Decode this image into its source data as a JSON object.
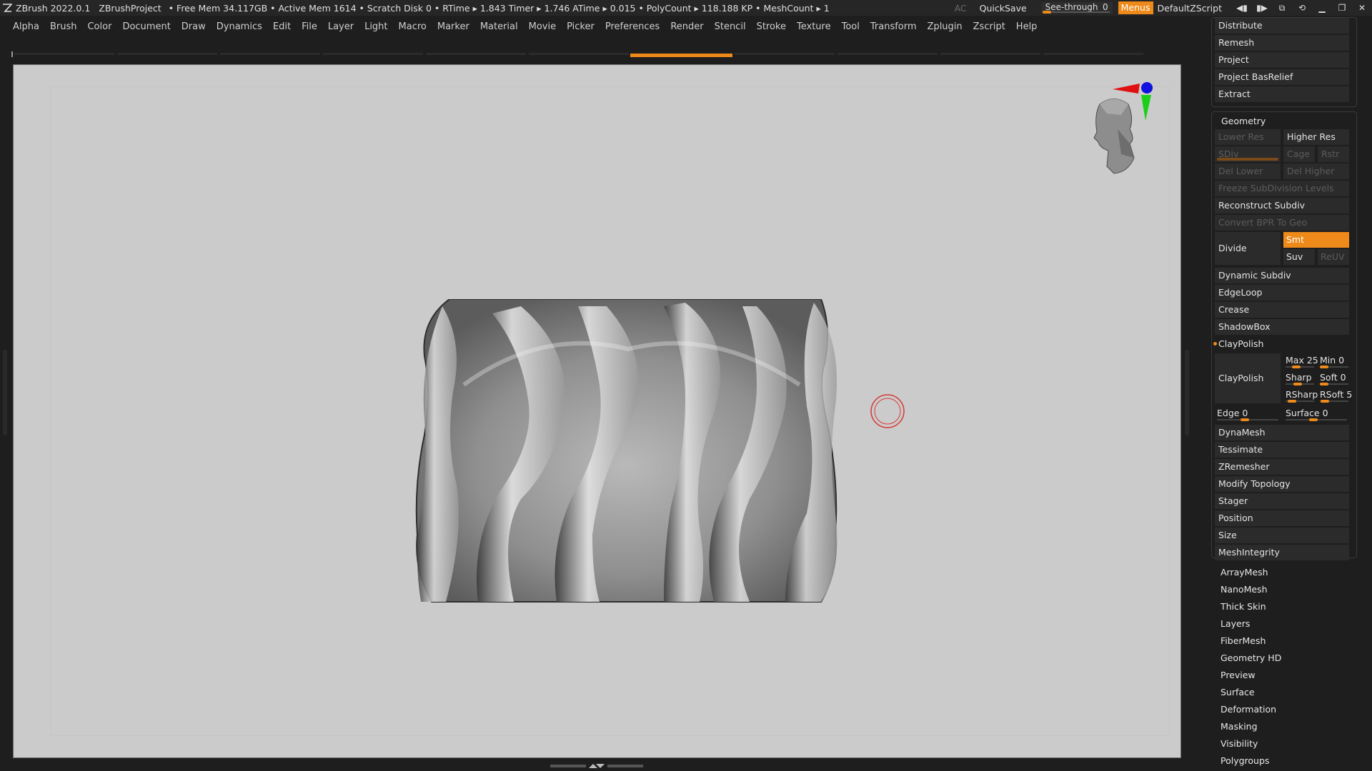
{
  "titlebar": {
    "app_name": "ZBrush 2022.0.1",
    "project": "ZBrushProject",
    "stats": "• Free Mem 34.117GB • Active Mem 1614 • Scratch Disk 0 •  RTime ▸ 1.843 Timer ▸ 1.746 ATime ▸ 0.015 • PolyCount ▸ 118.188 KP  • MeshCount ▸ 1",
    "ac_label": "AC",
    "quicksave_label": "QuickSave",
    "seethrough_label": "See-through",
    "seethrough_value": "0",
    "menus_label": "Menus",
    "script_label": "DefaultZScript",
    "icons": [
      "layout-prev-icon",
      "layout-next-icon",
      "ui-swap-icon",
      "cycle-icon",
      "minimize-icon",
      "restore-icon",
      "close-icon"
    ],
    "icon_glyphs": [
      "◀▮",
      "▮▶",
      "⧉",
      "⟲",
      "▁",
      "❐",
      "✕"
    ]
  },
  "menubar": {
    "items": [
      "Alpha",
      "Brush",
      "Color",
      "Document",
      "Draw",
      "Dynamics",
      "Edit",
      "File",
      "Layer",
      "Light",
      "Macro",
      "Marker",
      "Material",
      "Movie",
      "Picker",
      "Preferences",
      "Render",
      "Stencil",
      "Stroke",
      "Texture",
      "Tool",
      "Transform",
      "Zplugin",
      "Zscript",
      "Help"
    ]
  },
  "panel": {
    "top_items": [
      "Distribute",
      "Remesh",
      "Project",
      "Project BasRelief",
      "Extract"
    ],
    "geometry": {
      "title": "Geometry",
      "lower_res": "Lower Res",
      "higher_res": "Higher Res",
      "sdiv": "SDiv",
      "cage": "Cage",
      "rstr": "Rstr",
      "del_lower": "Del Lower",
      "del_higher": "Del Higher",
      "freeze": "Freeze SubDivision Levels",
      "reconstruct": "Reconstruct Subdiv",
      "convert_bpr": "Convert BPR To Geo",
      "divide": "Divide",
      "smt": "Smt",
      "suv": "Suv",
      "reuv": "ReUV",
      "dynamic_subdiv": "Dynamic Subdiv",
      "edgeloop": "EdgeLoop",
      "crease": "Crease",
      "shadowbox": "ShadowBox",
      "claypolish_header": "ClayPolish",
      "claypolish_btn": "ClayPolish",
      "max": "Max 25",
      "min": "Min 0",
      "sharp": "Sharp",
      "soft": "Soft 0",
      "rsharp": "RSharp",
      "rsoft": "RSoft 5",
      "edge": "Edge 0",
      "surface": "Surface 0",
      "bottom_items": [
        "DynaMesh",
        "Tessimate",
        "ZRemesher",
        "Modify Topology",
        "Stager",
        "Position",
        "Size",
        "MeshIntegrity"
      ]
    },
    "plain_items": [
      "ArrayMesh",
      "NanoMesh",
      "Thick Skin",
      "Layers",
      "FiberMesh",
      "Geometry HD",
      "Preview",
      "Surface",
      "Deformation",
      "Masking",
      "Visibility",
      "Polygroups"
    ]
  },
  "colors": {
    "accent": "#ee8a1a",
    "canvas_bg": "#cbcbcb",
    "ui_bg": "#1e1e1e",
    "button_bg": "#2b2b2b"
  }
}
